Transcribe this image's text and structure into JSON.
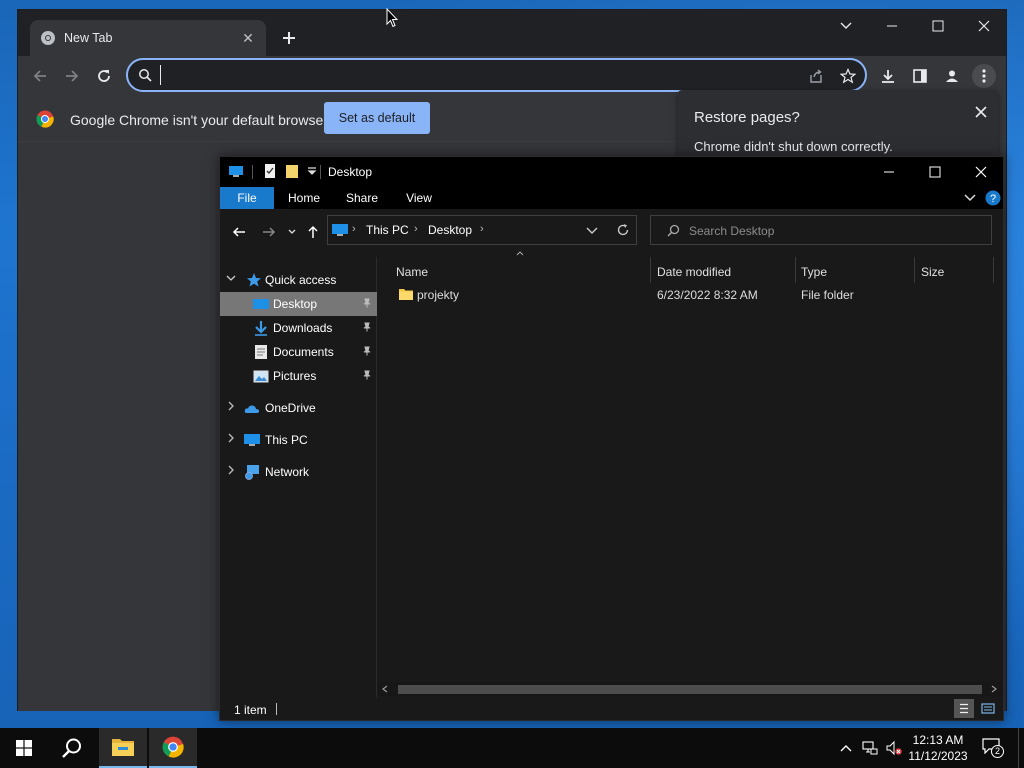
{
  "chrome": {
    "tab_title": "New Tab",
    "omnibox_value": "",
    "infobar_message": "Google Chrome isn't your default browser",
    "set_default_label": "Set as default",
    "restore_title": "Restore pages?",
    "restore_message": "Chrome didn't shut down correctly."
  },
  "explorer": {
    "title": "Desktop",
    "ribbon_tabs": [
      "File",
      "Home",
      "Share",
      "View"
    ],
    "breadcrumb": [
      "This PC",
      "Desktop"
    ],
    "search_placeholder": "Search Desktop",
    "nav": {
      "quick_access": "Quick access",
      "desktop": "Desktop",
      "downloads": "Downloads",
      "documents": "Documents",
      "pictures": "Pictures",
      "onedrive": "OneDrive",
      "this_pc": "This PC",
      "network": "Network"
    },
    "columns": [
      "Name",
      "Date modified",
      "Type",
      "Size"
    ],
    "files": [
      {
        "name": "projekty",
        "date": "6/23/2022 8:32 AM",
        "type": "File folder",
        "size": ""
      }
    ],
    "status": "1 item"
  },
  "taskbar": {
    "time": "12:13 AM",
    "date": "11/12/2023",
    "notification_count": "2"
  },
  "colors": {
    "accent": "#1979ca",
    "chrome_blue": "#8ab4f8",
    "desktop_blue": "#1e75d0"
  }
}
